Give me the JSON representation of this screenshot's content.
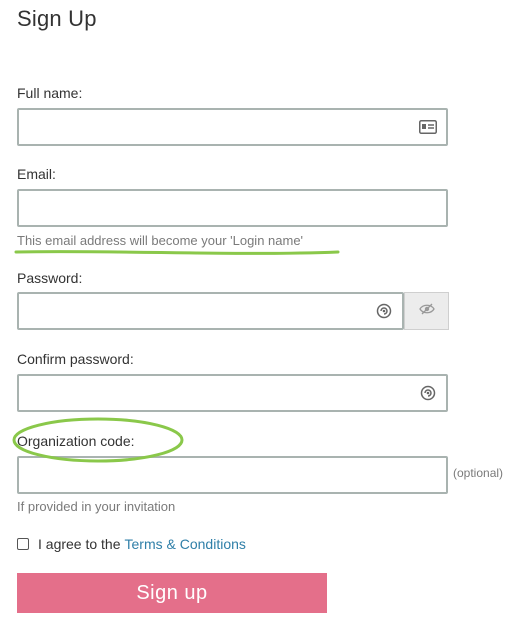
{
  "page": {
    "title": "Sign Up"
  },
  "form": {
    "full_name": {
      "label": "Full name:",
      "value": "",
      "icon": "contact-card-icon"
    },
    "email": {
      "label": "Email:",
      "value": "",
      "hint": "This email address will become your 'Login name'"
    },
    "password": {
      "label": "Password:",
      "value": "",
      "icon": "password-generate-icon",
      "toggle_icon": "eye-slash-icon"
    },
    "confirm_password": {
      "label": "Confirm password:",
      "value": "",
      "icon": "password-generate-icon"
    },
    "organization_code": {
      "label": "Organization code:",
      "value": "",
      "optional_text": "(optional)",
      "hint": "If provided in your invitation"
    },
    "terms": {
      "checked": false,
      "text": "I agree to the",
      "link_text": "Terms & Conditions"
    },
    "submit_label": "Sign up"
  },
  "colors": {
    "button": "#e46f8a",
    "link": "#2f7fa8",
    "annotation": "#8ac84a",
    "field_border": "#a9b3b0"
  }
}
